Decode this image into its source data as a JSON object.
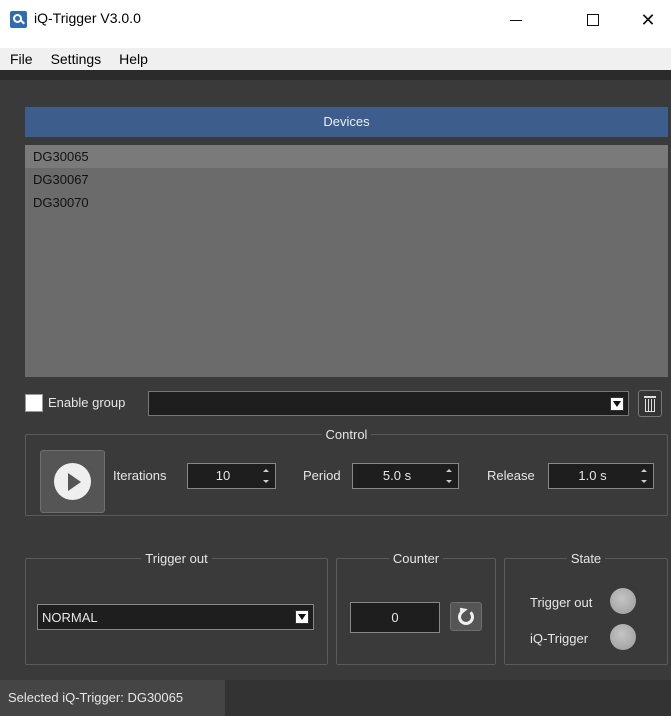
{
  "window": {
    "title": "iQ-Trigger V3.0.0",
    "min_glyph": "—",
    "close_glyph": "✕"
  },
  "menu": {
    "items": [
      "File",
      "Settings",
      "Help"
    ]
  },
  "devices": {
    "header": "Devices",
    "items": [
      "DG30065",
      "DG30067",
      "DG30070"
    ],
    "selected": "DG30065"
  },
  "group": {
    "enable_label": "Enable group",
    "checked": false,
    "selected_value": ""
  },
  "control": {
    "title": "Control",
    "iterations_label": "Iterations",
    "iterations_value": "10",
    "period_label": "Period",
    "period_value": "5.0 s",
    "release_label": "Release",
    "release_value": "1.0 s"
  },
  "trigger_out": {
    "title": "Trigger out",
    "selected": "NORMAL"
  },
  "counter": {
    "title": "Counter",
    "value": "0"
  },
  "state": {
    "title": "State",
    "trigger_out_label": "Trigger out",
    "iq_trigger_label": "iQ-Trigger"
  },
  "status": {
    "text": "Selected iQ-Trigger: DG30065"
  },
  "colors": {
    "background": "#3a3a3a",
    "header_blue": "#3d5e8c",
    "list_bg": "#6b6b6b",
    "led_off": "#b0b0b0"
  }
}
